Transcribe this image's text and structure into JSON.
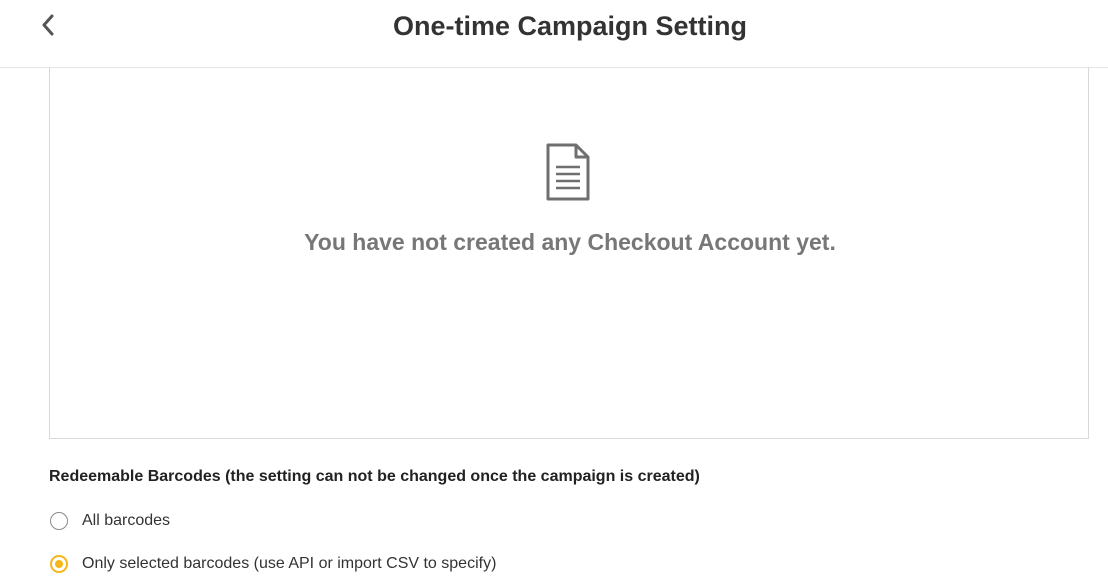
{
  "header": {
    "title": "One-time Campaign Setting",
    "back_icon": "chevron-left-icon"
  },
  "empty_state": {
    "icon": "document-icon",
    "message": "You have not created any Checkout Account yet."
  },
  "barcodes": {
    "label": "Redeemable Barcodes (the setting can not be changed once the campaign is created)",
    "options": [
      {
        "label": "All barcodes",
        "selected": false
      },
      {
        "label": "Only selected barcodes (use API or import CSV to specify)",
        "selected": true
      }
    ]
  },
  "colors": {
    "accent": "#f5b617",
    "empty_text": "#777777"
  }
}
